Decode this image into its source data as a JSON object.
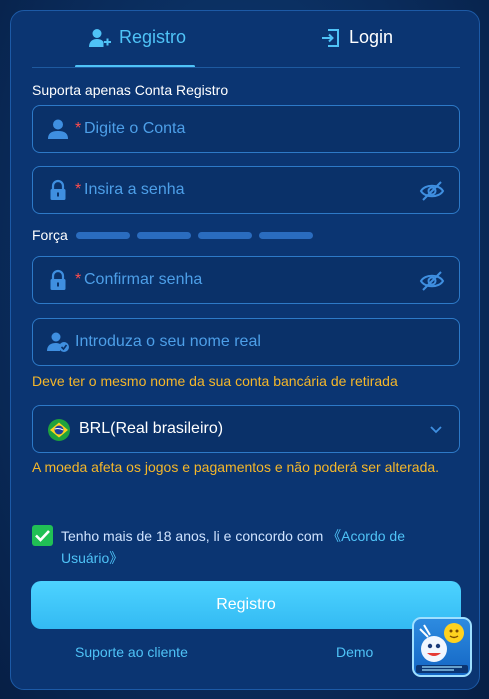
{
  "tabs": {
    "registro": "Registro",
    "login": "Login"
  },
  "form": {
    "support_note": "Suporta apenas Conta Registro",
    "account_required": "*",
    "account_placeholder": "Digite o Conta",
    "password_required": "*",
    "password_placeholder": "Insira a senha",
    "strength_label": "Força",
    "confirm_required": "*",
    "confirm_placeholder": "Confirmar senha",
    "realname_placeholder": "Introduza o seu nome real",
    "realname_warning": "Deve ter o mesmo nome da sua conta bancária de retirada",
    "currency_value": "BRL(Real brasileiro)",
    "currency_warning": "A moeda afeta os jogos e pagamentos e não poderá ser alterada.",
    "agree_text": "Tenho mais de 18 anos, li e concordo com",
    "agree_link": "《Acordo de Usuário》",
    "agree_checked": true,
    "submit": "Registro"
  },
  "footer": {
    "support": "Suporte ao cliente",
    "demo": "Demo"
  },
  "colors": {
    "accent": "#4fc3f7",
    "warning": "#f5b72a",
    "required": "#ff4d4d",
    "check": "#21c055"
  }
}
